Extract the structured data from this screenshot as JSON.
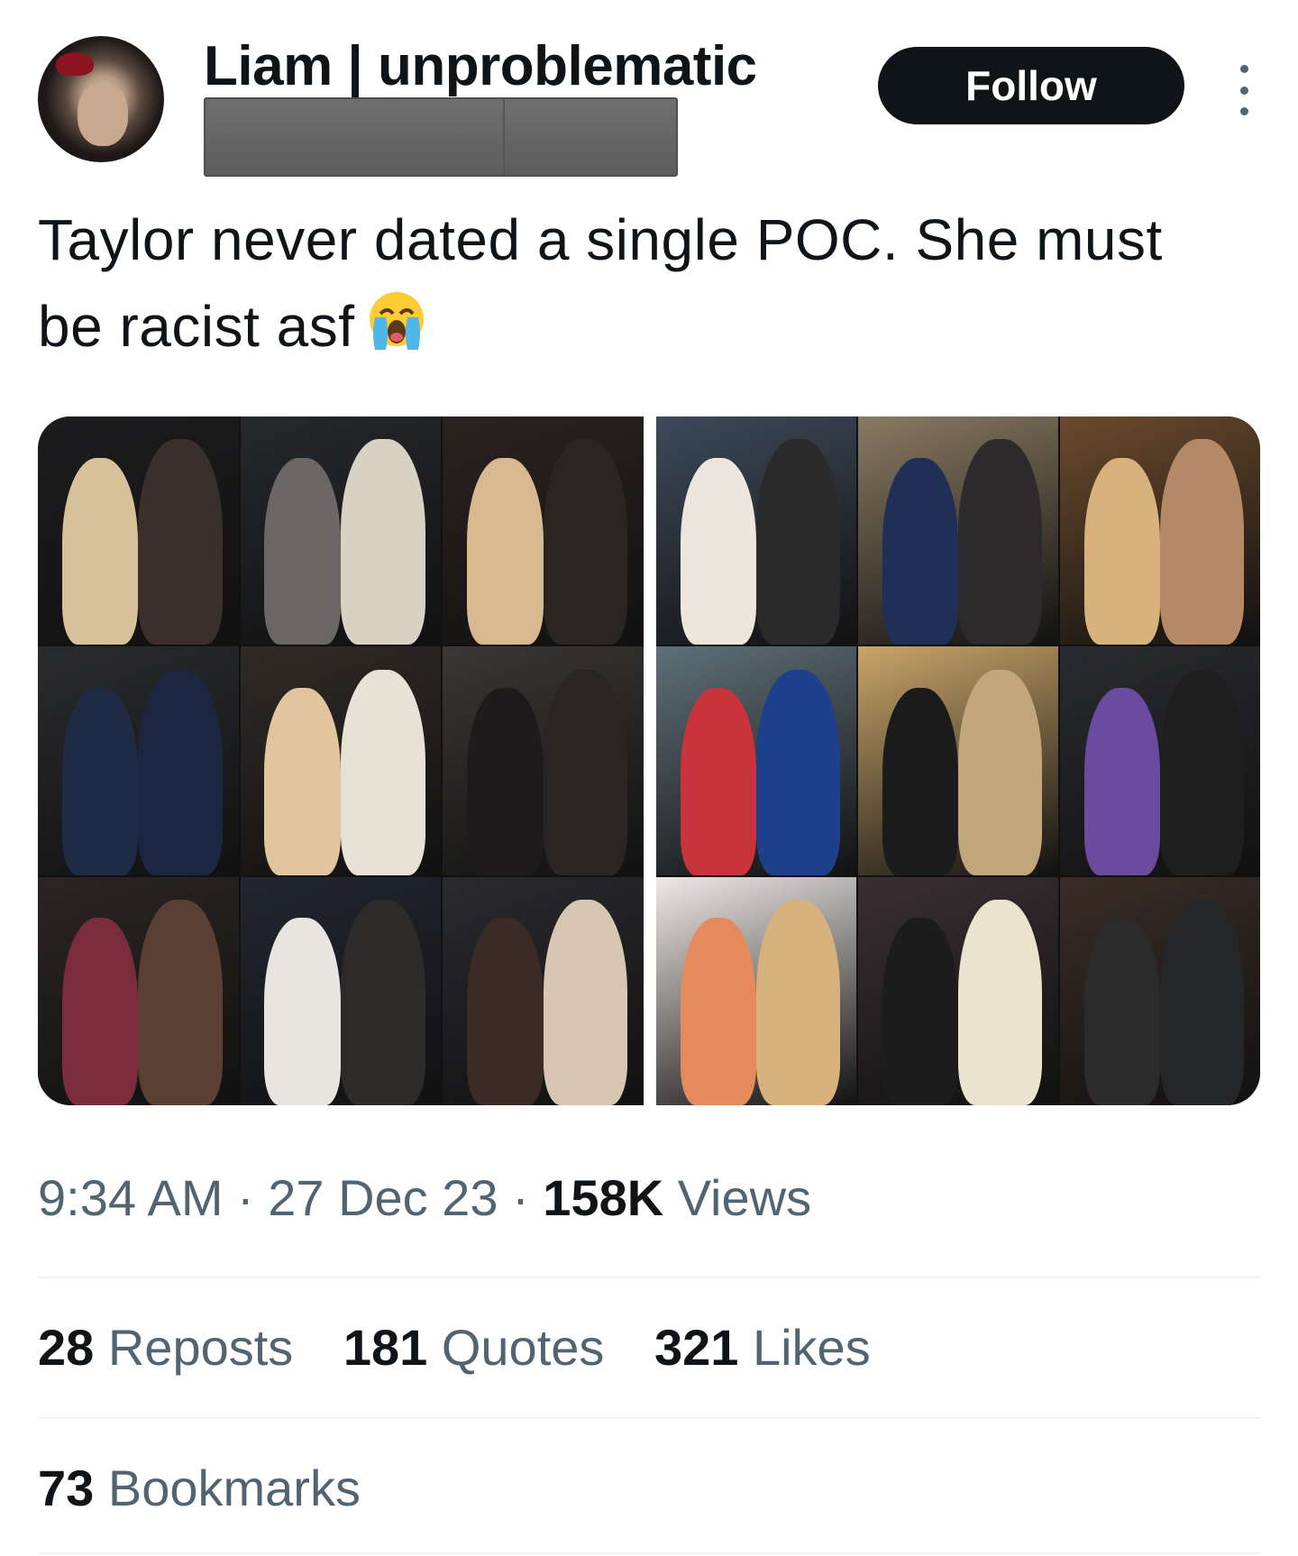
{
  "author": {
    "display_name": "Liam | unproblematic",
    "follow_label": "Follow"
  },
  "tweet": {
    "text": "Taylor never dated a single POC. She must be racist asf"
  },
  "meta": {
    "time": "9:34 AM",
    "sep1": " · ",
    "date": "27 Dec 23",
    "sep2": " · ",
    "views_count": "158K",
    "views_label": " Views"
  },
  "stats": {
    "reposts_count": "28",
    "reposts_label": " Reposts",
    "quotes_count": "181",
    "quotes_label": " Quotes",
    "likes_count": "321",
    "likes_label": " Likes",
    "bookmarks_count": "73",
    "bookmarks_label": " Bookmarks"
  },
  "colors": {
    "text": "#0f1419",
    "secondary": "#536471",
    "divider": "#eff3f4",
    "follow_bg": "#0f1419"
  },
  "icons": {
    "more": "more-vertical-icon",
    "emoji": "loudly-crying-face-icon"
  },
  "media": {
    "left_photos": [
      {
        "bg": "#1d1c1e",
        "a": "#d7c19a",
        "b": "#3a2f2a"
      },
      {
        "bg": "#26282c",
        "a": "#6b6565",
        "b": "#d9d2c4"
      },
      {
        "bg": "#2b2220",
        "a": "#d9b88f",
        "b": "#2a2522"
      },
      {
        "bg": "#2a2b2e",
        "a": "#1f2b45",
        "b": "#1d2640"
      },
      {
        "bg": "#302a26",
        "a": "#e2c59c",
        "b": "#e8e2d6"
      },
      {
        "bg": "#3a3734",
        "a": "#1d1b1b",
        "b": "#2a2424"
      },
      {
        "bg": "#2b2523",
        "a": "#7a2b3c",
        "b": "#5a4033"
      },
      {
        "bg": "#222631",
        "a": "#e8e4e0",
        "b": "#2c2b2a"
      },
      {
        "bg": "#2a2a2f",
        "a": "#3a2b25",
        "b": "#d7c7b2"
      }
    ],
    "right_photos": [
      {
        "bg": "#3d4a5a",
        "a": "#ece6de",
        "b": "#2a2a2a"
      },
      {
        "bg": "#8a7a62",
        "a": "#1f2f55",
        "b": "#2c2a2a"
      },
      {
        "bg": "#6b4a2c",
        "a": "#d8b27d",
        "b": "#b48a66"
      },
      {
        "bg": "#5f6f78",
        "a": "#c9333b",
        "b": "#1e3f8c"
      },
      {
        "bg": "#c9a56a",
        "a": "#1b1b1b",
        "b": "#c2a67c"
      },
      {
        "bg": "#2a2b30",
        "a": "#6b4ba0",
        "b": "#1e1e1e"
      },
      {
        "bg": "#efe9e6",
        "a": "#e58a5b",
        "b": "#d8b27d"
      },
      {
        "bg": "#3a2f33",
        "a": "#1c1c1c",
        "b": "#ece3cf"
      },
      {
        "bg": "#3a2c26",
        "a": "#2b2b2b",
        "b": "#252627"
      }
    ]
  }
}
